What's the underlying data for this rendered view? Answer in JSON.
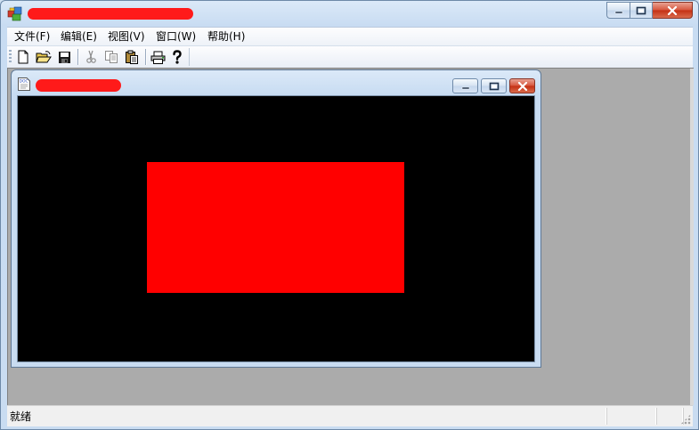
{
  "window": {
    "caption_buttons": [
      "minimize-icon",
      "maximize-icon",
      "close-icon"
    ]
  },
  "menubar": {
    "items": [
      {
        "label": "文件(F)"
      },
      {
        "label": "编辑(E)"
      },
      {
        "label": "视图(V)"
      },
      {
        "label": "窗口(W)"
      },
      {
        "label": "帮助(H)"
      }
    ]
  },
  "toolbar": {
    "buttons": [
      {
        "icon": "new-document-icon",
        "enabled": true
      },
      {
        "icon": "open-folder-icon",
        "enabled": true
      },
      {
        "icon": "save-disk-icon",
        "enabled": true
      },
      {
        "icon": "cut-scissors-icon",
        "enabled": false
      },
      {
        "icon": "copy-icon",
        "enabled": false
      },
      {
        "icon": "paste-clipboard-icon",
        "enabled": true
      },
      {
        "icon": "print-icon",
        "enabled": true
      },
      {
        "icon": "help-question-icon",
        "enabled": true
      }
    ]
  },
  "child_window": {
    "icon": "document-icon",
    "caption_buttons": [
      "minimize-icon",
      "restore-icon",
      "close-icon"
    ],
    "canvas": {
      "background": "#000000",
      "rectangle_color": "#ff0000"
    }
  },
  "statusbar": {
    "text": "就绪"
  },
  "colors": {
    "mdi_background": "#ababab",
    "redaction": "#ff1a1a"
  }
}
